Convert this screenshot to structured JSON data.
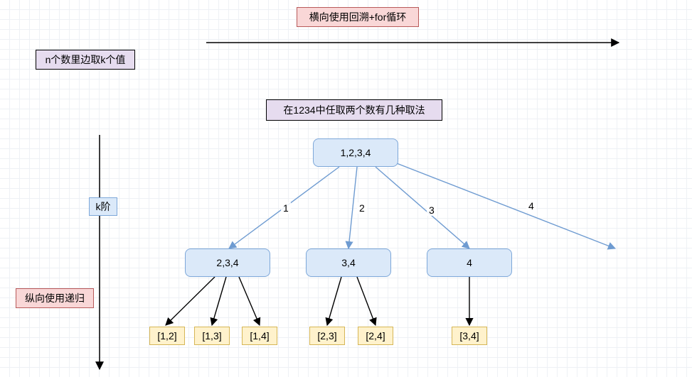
{
  "chart_data": {
    "type": "diagram",
    "title": "在1234中任取两个数有几种取法",
    "top_left_label": "n个数里边取k个值",
    "horizontal_axis_label": "横向使用回溯+for循环",
    "vertical_axis_label": "纵向使用递归",
    "k_label": "k阶",
    "root": "1,2,3,4",
    "level1": [
      {
        "edge": "1",
        "node": "2,3,4"
      },
      {
        "edge": "2",
        "node": "3,4"
      },
      {
        "edge": "3",
        "node": "4"
      },
      {
        "edge": "4",
        "node": null
      }
    ],
    "leaves": [
      {
        "parent": 0,
        "values": [
          "[1,2]",
          "[1,3]",
          "[1,4]"
        ]
      },
      {
        "parent": 1,
        "values": [
          "[2,3]",
          "[2,4]"
        ]
      },
      {
        "parent": 2,
        "values": [
          "[3,4]"
        ]
      }
    ]
  }
}
